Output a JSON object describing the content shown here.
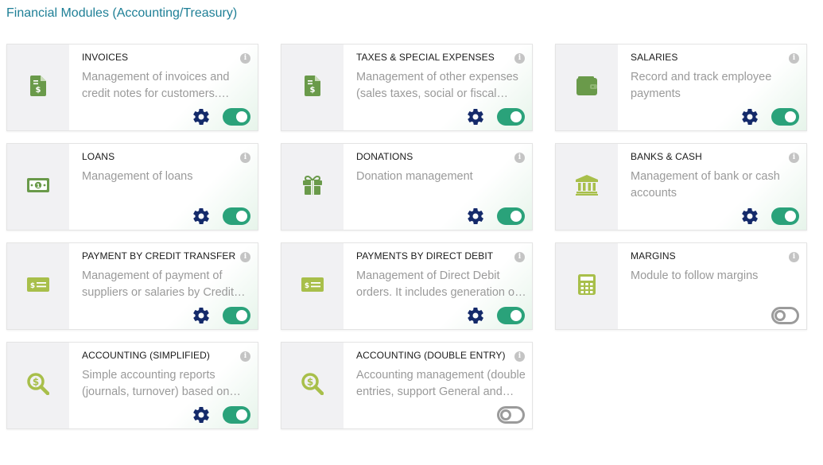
{
  "section": {
    "title": "Financial Modules (Accounting/Treasury)"
  },
  "colors": {
    "accent_text": "#1e7f96",
    "icon_green": "#6a9a4a",
    "icon_light_green": "#a8bf4a",
    "gear": "#142a6a",
    "toggle_on": "#2aa27a",
    "toggle_off": "#9b9b9b"
  },
  "modules": [
    {
      "title": "INVOICES",
      "description": "Management of invoices and credit notes for customers. Management of invoices for suppliers",
      "icon": "invoice-icon",
      "has_settings": true,
      "enabled": true
    },
    {
      "title": "TAXES & SPECIAL EXPENSES",
      "description": "Management of other expenses (sales taxes, social or fiscal taxes, dividends, ...)",
      "icon": "invoice-icon",
      "has_settings": true,
      "enabled": true
    },
    {
      "title": "SALARIES",
      "description": "Record and track employee payments",
      "icon": "wallet-icon",
      "has_settings": true,
      "enabled": true
    },
    {
      "title": "LOANS",
      "description": "Management of loans",
      "icon": "money-bill-icon",
      "has_settings": true,
      "enabled": true
    },
    {
      "title": "DONATIONS",
      "description": "Donation management",
      "icon": "gift-icon",
      "has_settings": true,
      "enabled": true
    },
    {
      "title": "BANKS & CASH",
      "description": "Management of bank or cash accounts",
      "icon": "bank-icon",
      "has_settings": true,
      "enabled": true
    },
    {
      "title": "PAYMENT BY CREDIT TRANSFER",
      "description": "Management of payment of suppliers or salaries by Credit Transfer orders",
      "icon": "card-icon",
      "has_settings": true,
      "enabled": true
    },
    {
      "title": "PAYMENTS BY DIRECT DEBIT",
      "description": "Management of Direct Debit orders. It includes generation of SEPA file",
      "icon": "card-icon",
      "has_settings": true,
      "enabled": true
    },
    {
      "title": "MARGINS",
      "description": "Module to follow margins",
      "icon": "calculator-icon",
      "has_settings": false,
      "enabled": false
    },
    {
      "title": "ACCOUNTING (SIMPLIFIED)",
      "description": "Simple accounting reports (journals, turnover) based on database content",
      "icon": "search-dollar-icon",
      "has_settings": true,
      "enabled": true
    },
    {
      "title": "ACCOUNTING (DOUBLE ENTRY)",
      "description": "Accounting management (double entries, support General and Subsidiary Ledgers)",
      "icon": "search-dollar-icon",
      "has_settings": false,
      "enabled": false
    }
  ]
}
